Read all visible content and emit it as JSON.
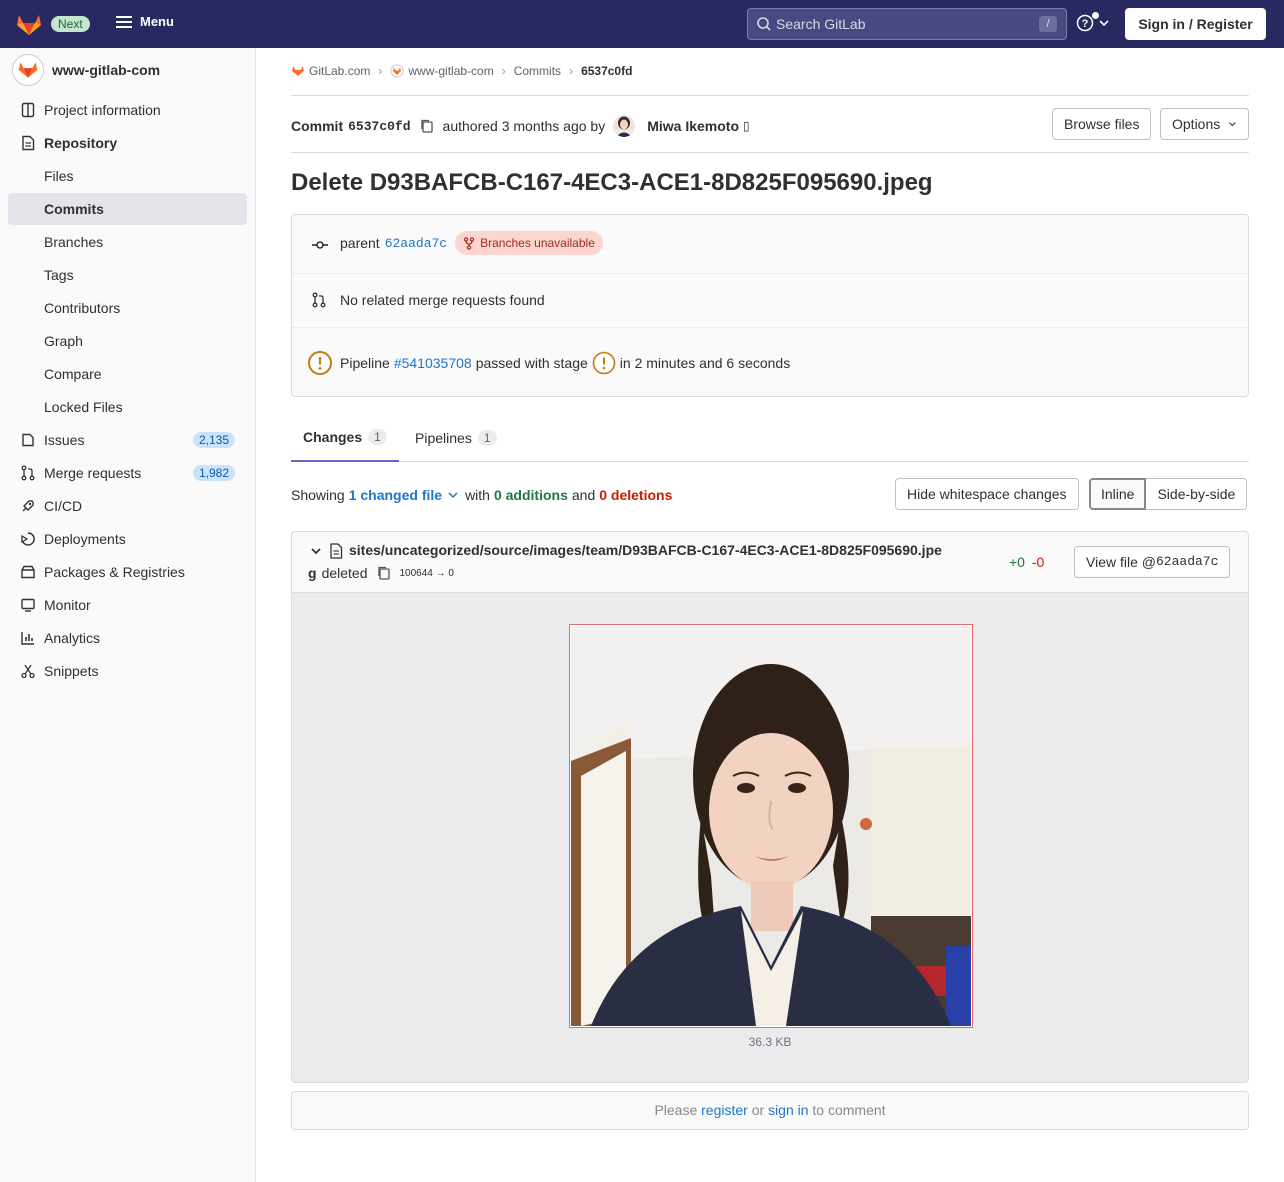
{
  "topbar": {
    "next_label": "Next",
    "menu_label": "Menu",
    "search_placeholder": "Search GitLab",
    "search_shortcut": "/",
    "signin_label": "Sign in / Register"
  },
  "sidebar": {
    "project_name": "www-gitlab-com",
    "items": [
      {
        "label": "Project information",
        "icon": "project-icon"
      },
      {
        "label": "Repository",
        "icon": "document-icon"
      },
      {
        "label": "Files"
      },
      {
        "label": "Commits"
      },
      {
        "label": "Branches"
      },
      {
        "label": "Tags"
      },
      {
        "label": "Contributors"
      },
      {
        "label": "Graph"
      },
      {
        "label": "Compare"
      },
      {
        "label": "Locked Files"
      },
      {
        "label": "Issues",
        "icon": "issues-icon",
        "count": "2,135"
      },
      {
        "label": "Merge requests",
        "icon": "merge-request-icon",
        "count": "1,982"
      },
      {
        "label": "CI/CD",
        "icon": "rocket-icon"
      },
      {
        "label": "Deployments",
        "icon": "deployments-icon"
      },
      {
        "label": "Packages & Registries",
        "icon": "package-icon"
      },
      {
        "label": "Monitor",
        "icon": "monitor-icon"
      },
      {
        "label": "Analytics",
        "icon": "chart-icon"
      },
      {
        "label": "Snippets",
        "icon": "snippet-icon"
      }
    ]
  },
  "breadcrumbs": [
    "GitLab.com",
    "www-gitlab-com",
    "Commits",
    "6537c0fd"
  ],
  "commit": {
    "label": "Commit",
    "sha": "6537c0fd",
    "authored_text": "authored 3 months ago by",
    "author": "Miwa Ikemoto",
    "browse_files": "Browse files",
    "options": "Options",
    "title": "Delete D93BAFCB-C167-4EC3-ACE1-8D825F095690.jpeg"
  },
  "info": {
    "parent_label": "parent",
    "parent_sha": "62aada7c",
    "branches_badge": "Branches unavailable",
    "no_mr_text": "No related merge requests found",
    "pipeline_label": "Pipeline",
    "pipeline_id": "#541035708",
    "pipeline_status": "passed with stage",
    "pipeline_duration": "in 2 minutes and 6 seconds"
  },
  "tabs": [
    {
      "label": "Changes",
      "count": "1"
    },
    {
      "label": "Pipelines",
      "count": "1"
    }
  ],
  "diff_summary": {
    "showing": "Showing",
    "changed_files": "1 changed file",
    "with": "with",
    "additions": "0 additions",
    "and": "and",
    "deletions": "0 deletions",
    "hide_whitespace": "Hide whitespace changes",
    "inline": "Inline",
    "side_by_side": "Side-by-side"
  },
  "file": {
    "path_line1": "sites/uncategorized/source/images/team/D93BAFCB-C167-4EC3-ACE1-8D825F095690.jpe",
    "path_line2": "g",
    "status": "deleted",
    "modes": "100644 → 0",
    "additions": "+0",
    "deletions": "-0",
    "view_file_label": "View file @",
    "view_file_sha": "62aada7c",
    "size": "36.3 KB"
  },
  "comment": {
    "please": "Please",
    "register": "register",
    "or": "or",
    "sign_in": "sign in",
    "to_comment": "to comment"
  },
  "colors": {
    "topbar_bg": "#292961",
    "link": "#1f75cb",
    "additions": "#217645",
    "deletions": "#c91c00",
    "pipeline_warning": "#c17d10"
  }
}
